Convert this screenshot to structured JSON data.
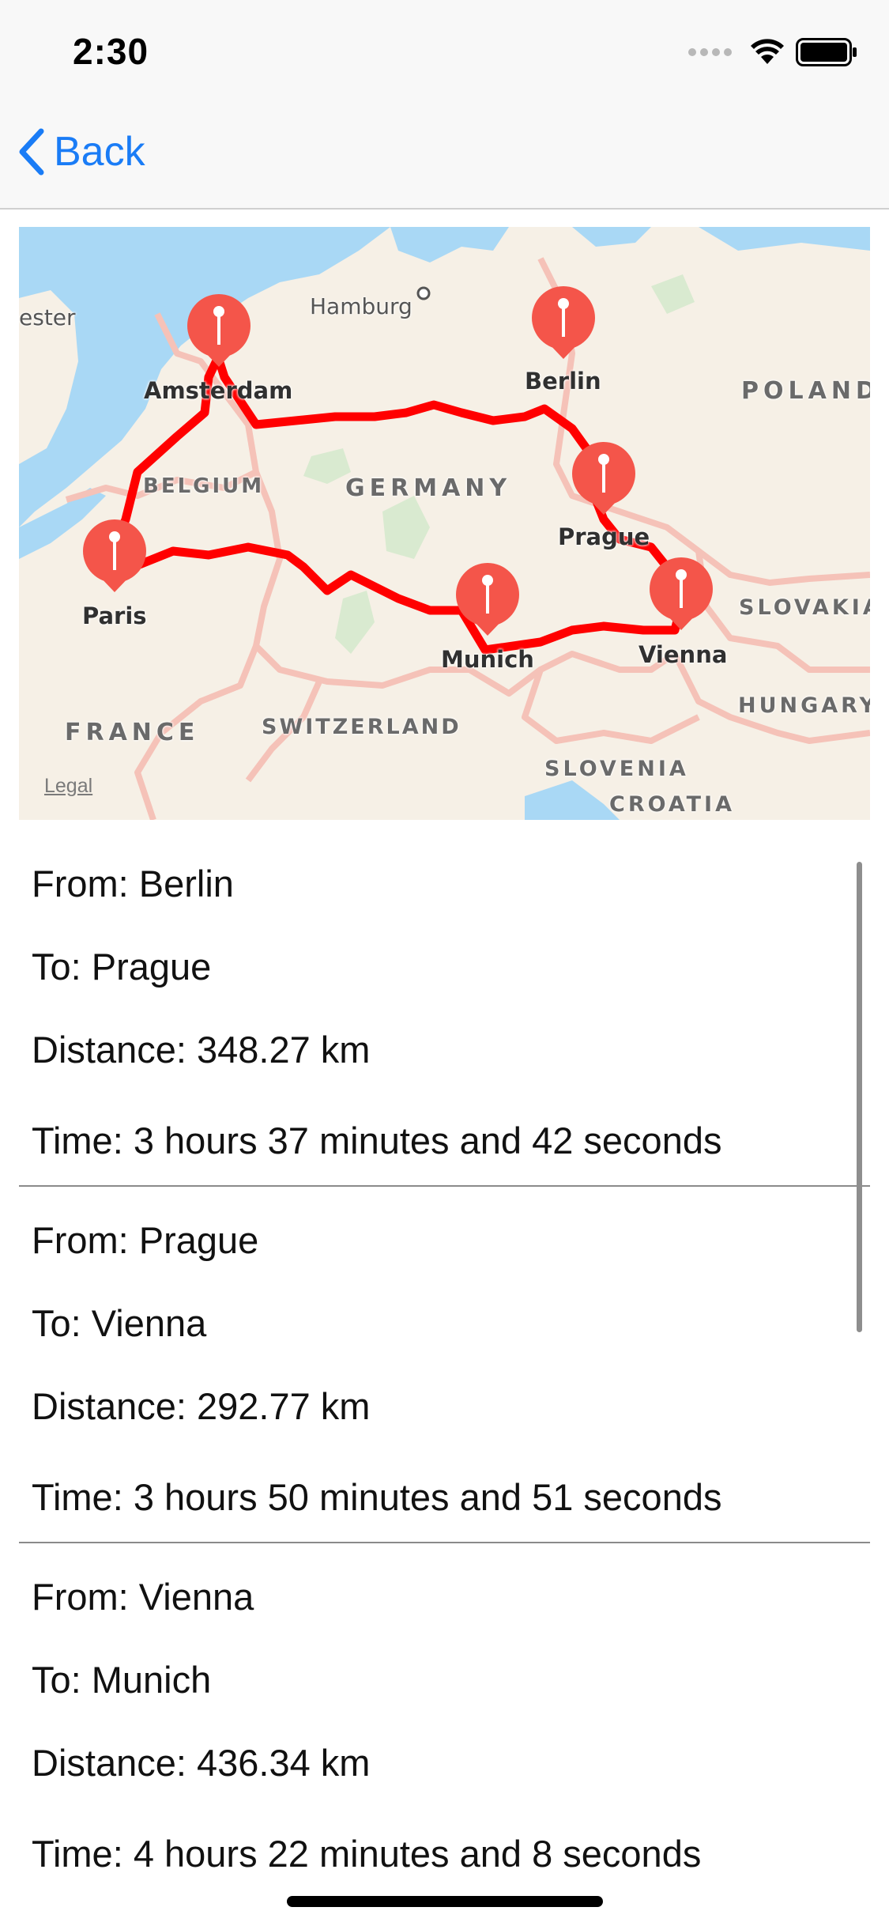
{
  "status_bar": {
    "time": "2:30"
  },
  "nav": {
    "back_label": "Back"
  },
  "map": {
    "cities": {
      "amsterdam": "Amsterdam",
      "berlin": "Berlin",
      "prague": "Prague",
      "vienna": "Vienna",
      "munich": "Munich",
      "paris": "Paris",
      "hamburg": "Hamburg",
      "partial_west": "ester"
    },
    "countries": {
      "germany": "GERMANY",
      "belgium": "BELGIUM",
      "poland": "POLAND",
      "slovakia": "SLOVAKIA",
      "hungary": "HUNGARY",
      "france": "FRANCE",
      "switzerland": "SWITZERLAND",
      "slovenia": "SLOVENIA",
      "croatia": "CROATIA"
    },
    "legal": "Legal",
    "route_color": "#ff0000",
    "pin_color": "#f4554a",
    "water_color": "#a9d8f5"
  },
  "routes": [
    {
      "from": "From: Berlin",
      "to": "To: Prague",
      "distance": "Distance: 348.27 km",
      "time": "Time: 3 hours 37 minutes and 42 seconds"
    },
    {
      "from": "From: Prague",
      "to": "To: Vienna",
      "distance": "Distance: 292.77 km",
      "time": "Time: 3 hours 50 minutes and 51 seconds"
    },
    {
      "from": "From: Vienna",
      "to": "To: Munich",
      "distance": "Distance: 436.34 km",
      "time": "Time: 4 hours 22 minutes and 8 seconds"
    }
  ]
}
